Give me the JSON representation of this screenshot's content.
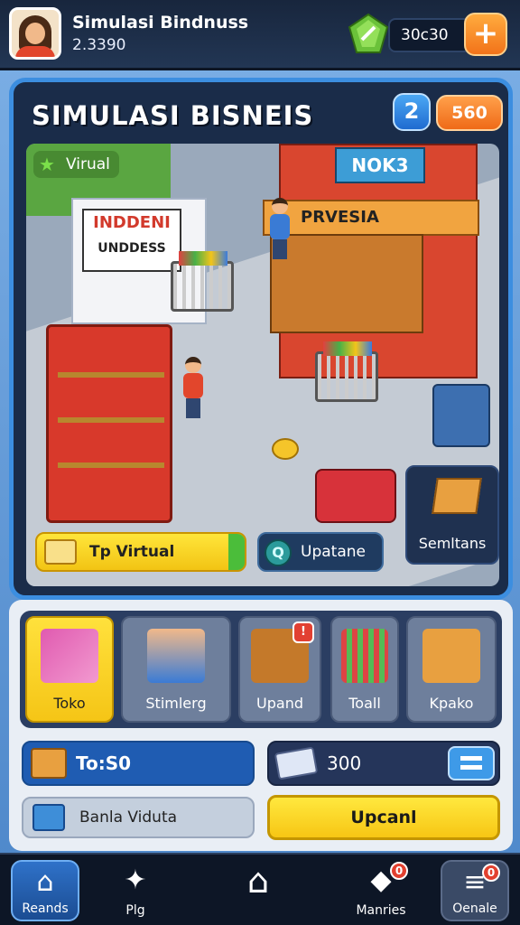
{
  "header": {
    "player_title": "Simulasi Bindnuss",
    "player_coins": "2.3390",
    "currency_value": "30c30",
    "add_label": "+"
  },
  "panel": {
    "title": "SIMULASI BISNEIS",
    "level": "2",
    "score": "560",
    "scene_chip": "Virual",
    "top_virtual": "Tp Virtual",
    "update_label": "Upatane",
    "semitans_label": "Semltans",
    "signs": {
      "left_store": "INDDENI",
      "left_store_sub": "UNDDESS",
      "right_store_top": "NOK3",
      "right_store_awning": "PRVESIA"
    }
  },
  "cards": [
    {
      "label": "Toko",
      "badge": ""
    },
    {
      "label": "Stimlerg",
      "badge": ""
    },
    {
      "label": "Upand",
      "badge": "!"
    },
    {
      "label": "Toall",
      "badge": ""
    },
    {
      "label": "Kpako",
      "badge": ""
    }
  ],
  "resources": {
    "stock_label": "To:S0",
    "money_value": "300",
    "bank_label": "Banla Viduta",
    "upgrade_label": "Upcanl"
  },
  "nav": [
    {
      "label": "Reands",
      "icon": "home-icon",
      "glyph": "⌂",
      "badge": ""
    },
    {
      "label": "Plg",
      "icon": "puzzle-icon",
      "glyph": "✦",
      "badge": ""
    },
    {
      "label": "",
      "icon": "house-outline-icon",
      "glyph": "⌂",
      "badge": ""
    },
    {
      "label": "Manries",
      "icon": "box-icon",
      "glyph": "◆",
      "badge": "0"
    },
    {
      "label": "Oenale",
      "icon": "menu-icon",
      "glyph": "≡",
      "badge": "0"
    }
  ],
  "colors": {
    "accent_blue": "#3c8ee0",
    "accent_orange": "#f2731a",
    "accent_yellow": "#f5c516",
    "panel_dark": "#1a2c49"
  }
}
